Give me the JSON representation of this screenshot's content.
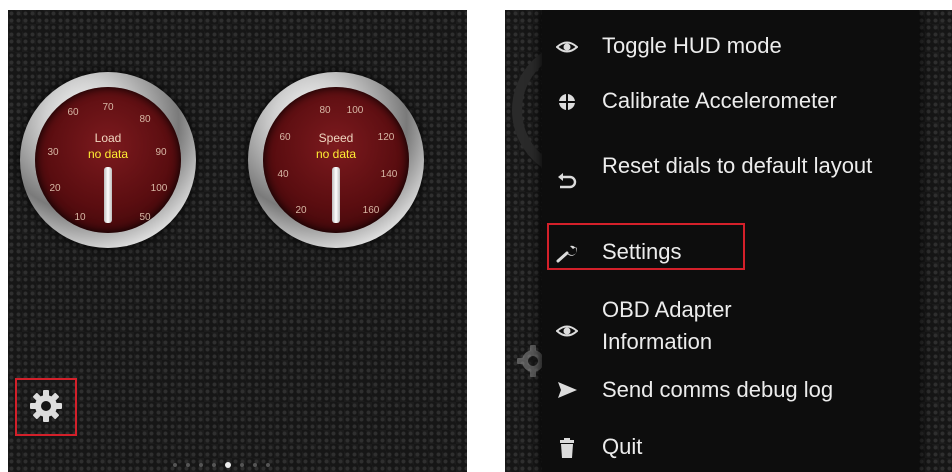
{
  "gauges": [
    {
      "title": "Load",
      "value": "no data",
      "ticks": [
        "60",
        "70",
        "80",
        "90",
        "100",
        "10",
        "20",
        "30",
        "40",
        "50"
      ]
    },
    {
      "title": "Speed",
      "value": "no data",
      "ticks": [
        "80",
        "100",
        "120",
        "140",
        "160",
        "20",
        "40",
        "60"
      ]
    }
  ],
  "pager": {
    "count": 8,
    "active": 4
  },
  "menu": {
    "items": [
      {
        "label": "Toggle HUD mode",
        "icon": "eye-icon"
      },
      {
        "label": "Calibrate Accelerometer",
        "icon": "crosshair-icon"
      },
      {
        "label": "Reset dials to default layout",
        "icon": "undo-icon"
      },
      {
        "label": "Settings",
        "icon": "wrench-icon"
      },
      {
        "label": "OBD Adapter Information",
        "icon": "eye-icon"
      },
      {
        "label": "Send comms debug log",
        "icon": "send-icon"
      },
      {
        "label": "Quit",
        "icon": "trash-icon"
      }
    ]
  },
  "colors": {
    "highlight": "#d3202a",
    "gauge_face": "#5a0d10",
    "gauge_value": "#ffee33",
    "menu_bg": "#0d0d0d",
    "menu_text": "#ececec"
  }
}
